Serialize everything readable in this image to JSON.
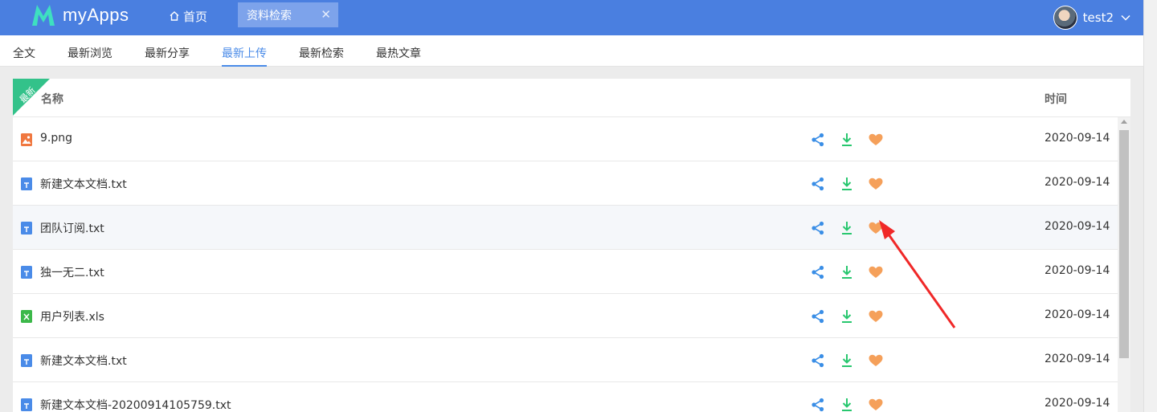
{
  "app": {
    "title": "myApps"
  },
  "nav": {
    "home_label": "首页",
    "active_tab_label": "资料检索",
    "active_tab_close": "✕"
  },
  "user": {
    "name": "test2"
  },
  "subtabs": [
    {
      "label": "全文"
    },
    {
      "label": "最新浏览"
    },
    {
      "label": "最新分享"
    },
    {
      "label": "最新上传"
    },
    {
      "label": "最新检索"
    },
    {
      "label": "最热文章"
    }
  ],
  "active_subtab": "最新上传",
  "ribbon": {
    "label": "最新"
  },
  "table": {
    "headers": {
      "name": "名称",
      "time": "时间"
    },
    "rows": [
      {
        "icon": "image-file-icon",
        "name": "9.png",
        "time": "2020-09-14"
      },
      {
        "icon": "text-file-icon",
        "name": "新建文本文档.txt",
        "time": "2020-09-14"
      },
      {
        "icon": "text-file-icon",
        "name": "团队订阅.txt",
        "time": "2020-09-14"
      },
      {
        "icon": "text-file-icon",
        "name": "独一无二.txt",
        "time": "2020-09-14"
      },
      {
        "icon": "excel-file-icon",
        "name": "用户列表.xls",
        "time": "2020-09-14"
      },
      {
        "icon": "text-file-icon",
        "name": "新建文本文档.txt",
        "time": "2020-09-14"
      },
      {
        "icon": "text-file-icon",
        "name": "新建文本文档-20200914105759.txt",
        "time": "2020-09-14"
      }
    ]
  },
  "colors": {
    "header_bg": "#4a7fe0",
    "accent": "#4a8be8",
    "ribbon": "#33c28a",
    "share_icon": "#3a8ee6",
    "download_icon": "#28c76f",
    "favorite_icon": "#f5a05a",
    "annotation_arrow": "#f02828"
  }
}
